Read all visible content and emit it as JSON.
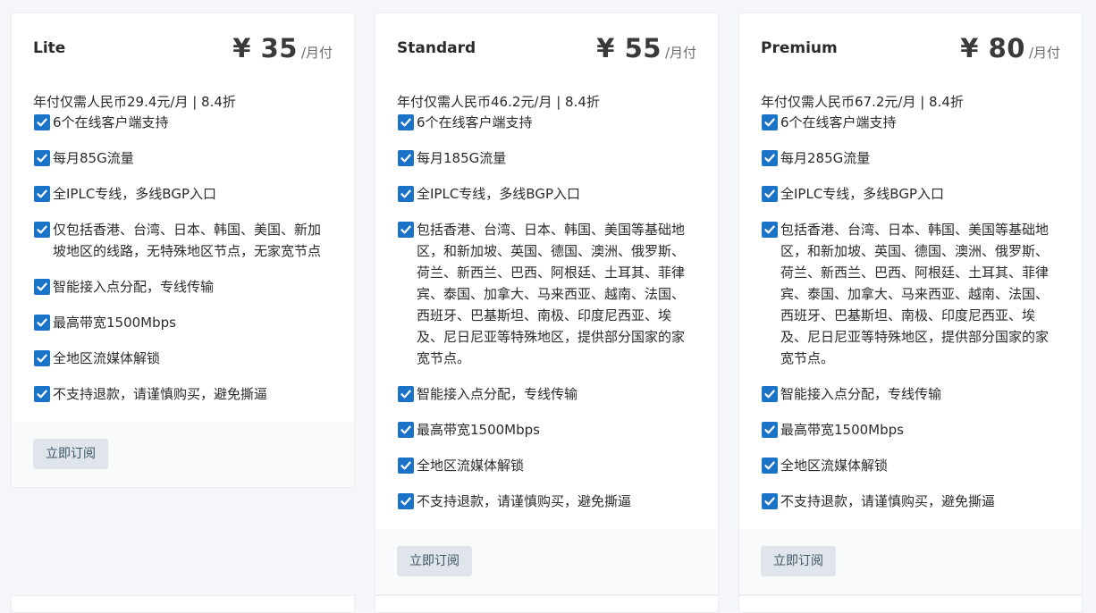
{
  "plans": [
    {
      "name": "Lite",
      "price": "¥ 35",
      "unit": "/月付",
      "annual": "年付仅需人民币29.4元/月 | 8.4折",
      "features": [
        "6个在线客户端支持",
        "每月85G流量",
        "全IPLC专线，多线BGP入口",
        "仅包括香港、台湾、日本、韩国、美国、新加坡地区的线路，无特殊地区节点，无家宽节点",
        "智能接入点分配，专线传输",
        "最高带宽1500Mbps",
        "全地区流媒体解锁",
        "不支持退款，请谨慎购买，避免撕逼"
      ],
      "button": "立即订阅"
    },
    {
      "name": "Standard",
      "price": "¥ 55",
      "unit": "/月付",
      "annual": "年付仅需人民币46.2元/月 | 8.4折",
      "features": [
        "6个在线客户端支持",
        "每月185G流量",
        "全IPLC专线，多线BGP入口",
        "包括香港、台湾、日本、韩国、美国等基础地区，和新加坡、英国、德国、澳洲、俄罗斯、荷兰、新西兰、巴西、阿根廷、土耳其、菲律宾、泰国、加拿大、马来西亚、越南、法国、西班牙、巴基斯坦、南极、印度尼西亚、埃及、尼日尼亚等特殊地区，提供部分国家的家宽节点。",
        "智能接入点分配，专线传输",
        "最高带宽1500Mbps",
        "全地区流媒体解锁",
        "不支持退款，请谨慎购买，避免撕逼"
      ],
      "button": "立即订阅"
    },
    {
      "name": "Premium",
      "price": "¥ 80",
      "unit": "/月付",
      "annual": "年付仅需人民币67.2元/月 | 8.4折",
      "features": [
        "6个在线客户端支持",
        "每月285G流量",
        "全IPLC专线，多线BGP入口",
        "包括香港、台湾、日本、韩国、美国等基础地区，和新加坡、英国、德国、澳洲、俄罗斯、荷兰、新西兰、巴西、阿根廷、土耳其、菲律宾、泰国、加拿大、马来西亚、越南、法国、西班牙、巴基斯坦、南极、印度尼西亚、埃及、尼日尼亚等特殊地区，提供部分国家的家宽节点。",
        "智能接入点分配，专线传输",
        "最高带宽1500Mbps",
        "全地区流媒体解锁",
        "不支持退款，请谨慎购买，避免撕逼"
      ],
      "button": "立即订阅"
    }
  ],
  "icons": {
    "feature_check": "checkbox-checked-icon"
  },
  "colors": {
    "check": "#1a73c6",
    "button_bg": "#dfe5ea",
    "button_text": "#3d5566",
    "page_bg": "#f5f6fa"
  }
}
